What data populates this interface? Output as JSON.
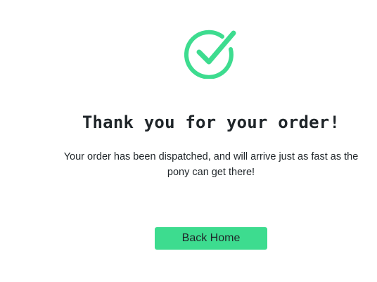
{
  "confirmation": {
    "icon": "check-circle-icon",
    "title": "Thank you for your order!",
    "message": "Your order has been dispatched, and will arrive just as fast as the pony can get there!",
    "back_button_label": "Back Home"
  },
  "colors": {
    "accent": "#3ddc8f",
    "text": "#1f2529",
    "background": "#ffffff"
  }
}
